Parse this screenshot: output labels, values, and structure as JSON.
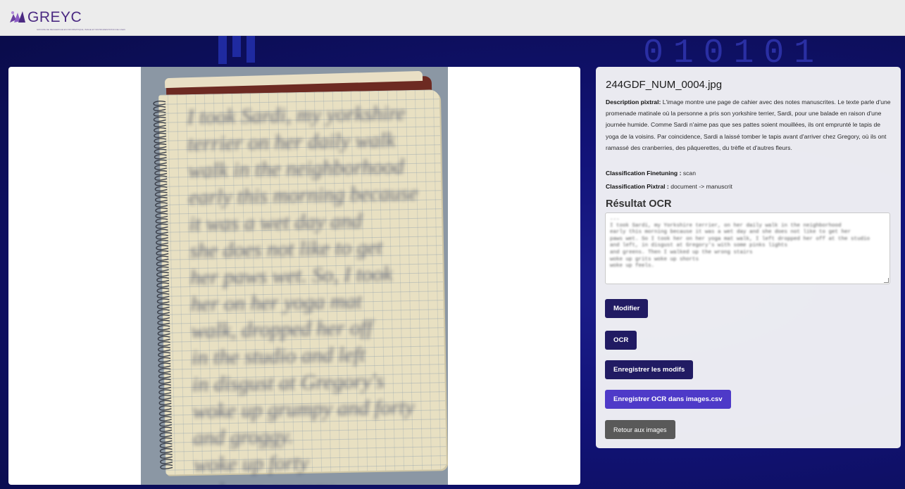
{
  "brand": {
    "name": "GREYC",
    "tagline": "GROUPE DE RECHERCHE EN INFORMATIQUE, IMAGE ET INSTRUMENTATION DE CAEN"
  },
  "background": {
    "digits": "010101"
  },
  "image": {
    "handwriting": "I took Sardi, my yorkshire\nterrier on her daily walk\nwalk in the neighborhood\nearly this morning because\nit was a wet day and\nshe does not like to get\nher paws wet. So, I took\nher on her yoga mat\nwalk, dropped her off\nin the studio and left\nin disgust at Gregory's\nwoke up grumpy and forty\nand groggy.\nwoke up forty\nwoke up grumpy\nwoke up fog."
  },
  "panel": {
    "filename": "244GDF_NUM_0004.jpg",
    "description_label": "Description pixtral:",
    "description_text": "L'image montre une page de cahier avec des notes manuscrites. Le texte parle d'une promenade matinale où la personne a pris son yorkshire terrier, Sardi, pour une balade en raison d'une journée humide. Comme Sardi n'aime pas que ses pattes soient mouillées, ils ont emprunté le tapis de yoga de la voisins. Par coincidence, Sardi a laissé tomber le tapis avant d'arriver chez Gregory, où ils ont ramassé des cranberries, des pâquerettes, du trèfle et d'autres fleurs.",
    "finetuning_label": "Classification Finetuning :",
    "finetuning_value": "scan",
    "pixtral_label": "Classification Pixtral :",
    "pixtral_value": "document -> manuscrit",
    "ocr_title": "Résultat OCR",
    "ocr_text": "...\nI took Sardi, my Yorkshire terrier, on her daily walk in the neighborhood\nearly this morning because it was a wet day and she does not like to get her\npaws wet. So I took her on her yoga mat walk, I left dropped her off at the studio\nand left, in disgust at Gregory's with some pinks lights\nand greens. Then I walked up the wrong stairs\nwoke up grits woke up shorts\nwoke up feels.",
    "buttons": {
      "modifier": "Modifier",
      "ocr": "OCR",
      "save_edits": "Enregistrer les modifs",
      "save_ocr": "Enregistrer OCR dans images.csv",
      "back": "Retour aux images"
    }
  }
}
